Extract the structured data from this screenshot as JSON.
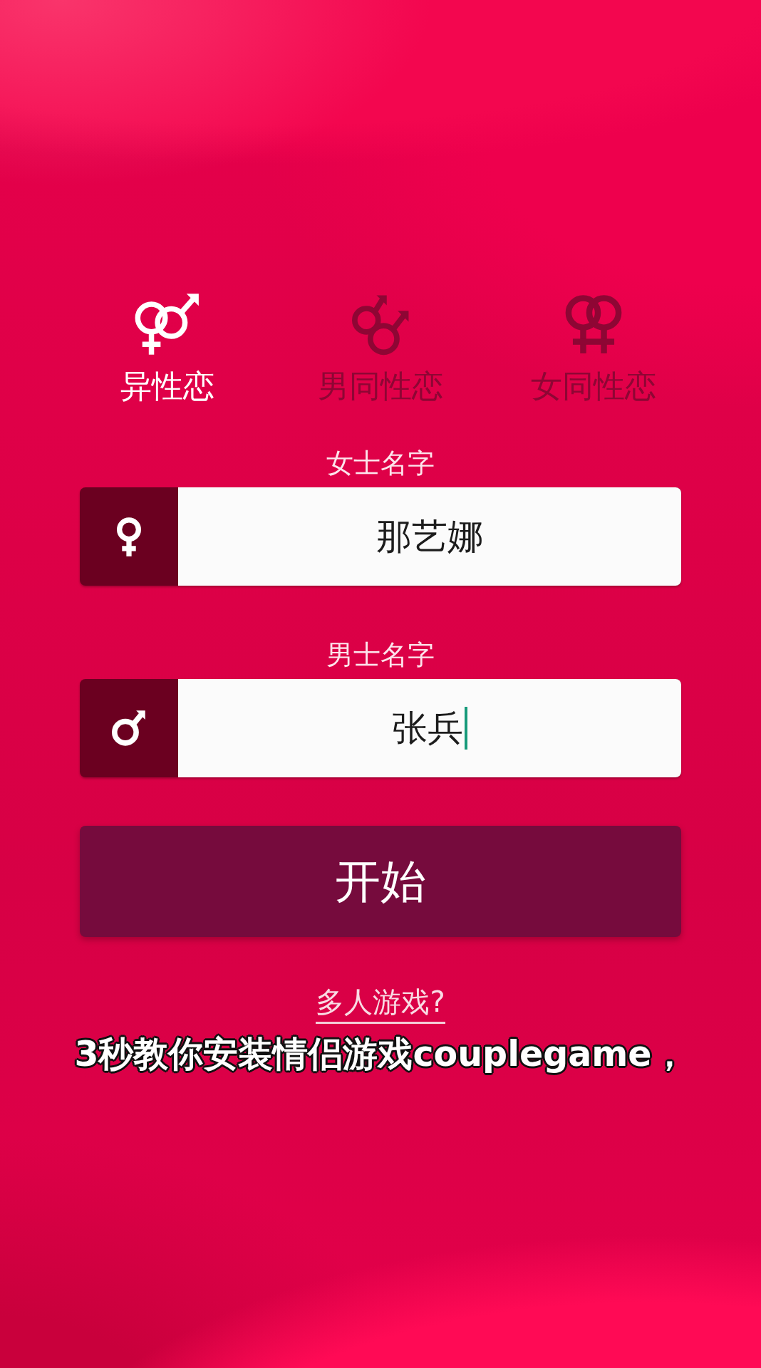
{
  "tabs": [
    {
      "label": "异性恋",
      "kind": "hetero",
      "selected": true
    },
    {
      "label": "男同性恋",
      "kind": "gay",
      "selected": false
    },
    {
      "label": "女同性恋",
      "kind": "lesbian",
      "selected": false
    }
  ],
  "fields": [
    {
      "label": "女士名字",
      "kind": "female",
      "value": "那艺娜",
      "focused": false
    },
    {
      "label": "男士名字",
      "kind": "male",
      "value": "张兵",
      "focused": true
    }
  ],
  "start_button": {
    "label": "开始"
  },
  "multiplayer_link": {
    "label": "多人游戏?"
  },
  "caption": "3秒教你安装情侣游戏couplegame，"
}
